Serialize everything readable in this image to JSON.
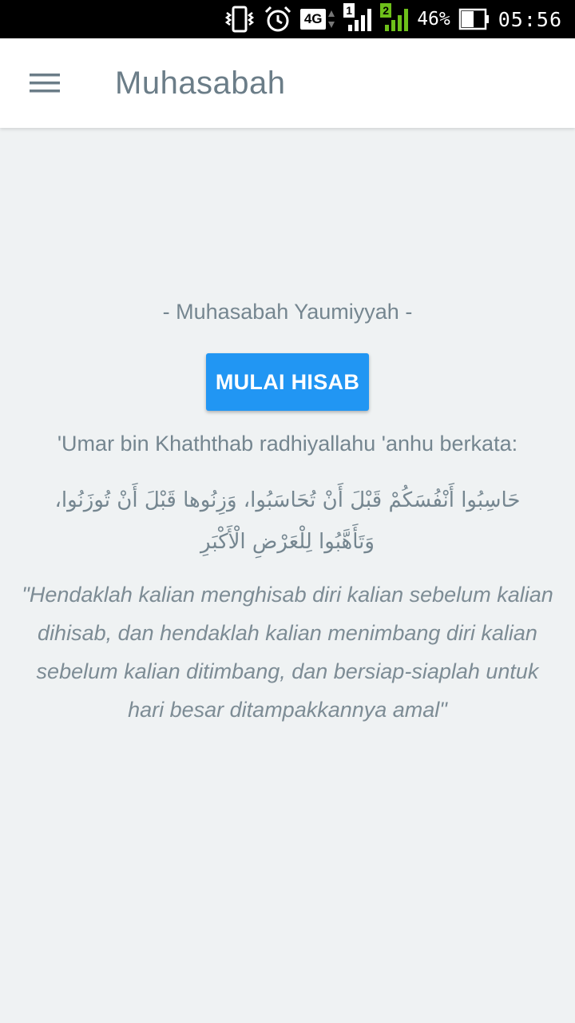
{
  "status_bar": {
    "network": "4G",
    "sim1": "1",
    "sim2": "2",
    "battery_percent": "46%",
    "time": "05:56",
    "icons": [
      "vibrate-icon",
      "alarm-icon",
      "4g-icon",
      "signal-sim1-icon",
      "signal-sim2-icon",
      "battery-icon"
    ],
    "accent_sim2": "#6ec01a"
  },
  "app_bar": {
    "title": "Muhasabah",
    "menu_icon": "hamburger-menu-icon"
  },
  "main": {
    "subtitle": "- Muhasabah Yaumiyyah -",
    "start_button_label": "MULAI HISAB",
    "attribution": "'Umar bin Khaththab radhiyallahu 'anhu berkata:",
    "arabic_quote": "حَاسِبُوا أَنْفُسَكُمْ قَبْلَ أَنْ تُحَاسَبُوا، وَزِنُوها قَبْلَ أَنْ تُوزَنُوا، وَتَأَهَّبُوا لِلْعَرْضِ الْأَكْبَرِ",
    "translation": "\"Hendaklah kalian menghisab diri kalian sebelum kalian dihisab, dan hendaklah kalian menimbang diri kalian sebelum kalian ditimbang, dan bersiap-siaplah untuk hari besar ditampakkannya amal\""
  },
  "colors": {
    "primary_button": "#2196f3",
    "background": "#eff2f3",
    "text_muted": "#758690"
  }
}
